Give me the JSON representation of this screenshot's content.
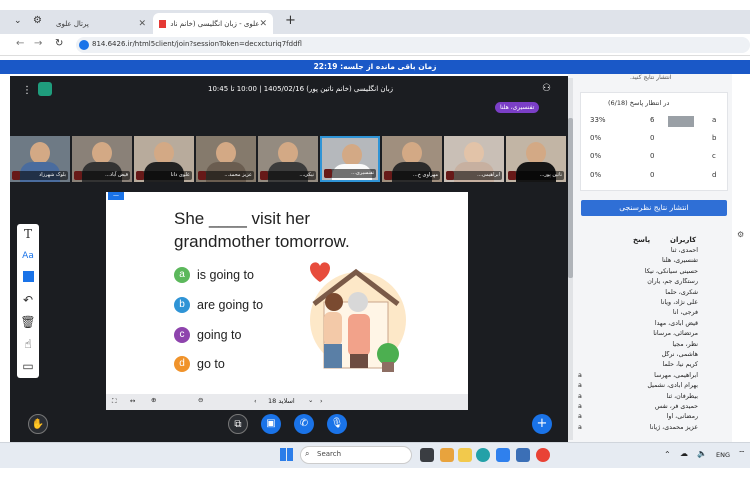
{
  "browser": {
    "tab1_title": "پرتال علوی",
    "tab2_title": "علوی - زبان انگلیسی (خانم ناد",
    "url": "814.6426.ir/html5client/join?sessionToken=decxcturiq7fddfl"
  },
  "meeting": {
    "timer": "زمان باقی مانده از جلسه: 22:19",
    "header_title": "زبان انگلیسی (خانم ناتین پور) 1405/02/16 | 10:00 تا 10:45",
    "presenter": "تفنسیری، هلنا"
  },
  "videos": [
    {
      "name": "بلوک شهرزاد"
    },
    {
      "name": "قیض آباد..."
    },
    {
      "name": "علوی دانا"
    },
    {
      "name": "عزیز محمد..."
    },
    {
      "name": "نیکی..."
    },
    {
      "name": "تفنسیری..."
    },
    {
      "name": "مهراوی خ..."
    },
    {
      "name": "ابراهیمی..."
    },
    {
      "name": "ناتین پور..."
    }
  ],
  "slide": {
    "sentence_line1": "She ____ visit her",
    "sentence_line2": "grandmother tomorrow.",
    "options": [
      {
        "letter": "a",
        "text": "is going to",
        "color": "#5cb85c"
      },
      {
        "letter": "b",
        "text": "are going to",
        "color": "#2f94d6"
      },
      {
        "letter": "c",
        "text": "going to",
        "color": "#8e44ad"
      },
      {
        "letter": "d",
        "text": "go to",
        "color": "#f0932b"
      }
    ],
    "slide_label": "اسلاید 18"
  },
  "poll": {
    "truncated_top": "انتشار نتایج کنید.",
    "waiting": "در انتظار پاسخ (6/18)",
    "rows": [
      {
        "label": "a",
        "count": "6",
        "percent": "33%",
        "fill": 0.33
      },
      {
        "label": "b",
        "count": "0",
        "percent": "0%",
        "fill": 0
      },
      {
        "label": "c",
        "count": "0",
        "percent": "0%",
        "fill": 0
      },
      {
        "label": "d",
        "count": "0",
        "percent": "0%",
        "fill": 0
      }
    ],
    "publish_button": "انتشار نتایج نظرسنجی",
    "col_users": "کاربران",
    "col_answer": "پاسخ",
    "users": [
      {
        "name": "احمدی، ثنا",
        "answer": ""
      },
      {
        "name": "تفنسیری، هلنا",
        "answer": ""
      },
      {
        "name": "حسینی سیانکی، نیکا",
        "answer": ""
      },
      {
        "name": "رستگاری جم، یاران",
        "answer": ""
      },
      {
        "name": "شکری، حلما",
        "answer": ""
      },
      {
        "name": "علی نژاد، ویانا",
        "answer": ""
      },
      {
        "name": "فرجی، آنا",
        "answer": ""
      },
      {
        "name": "قیض آبادی، مهدا",
        "answer": ""
      },
      {
        "name": "مرتضائی، مرسانا",
        "answer": ""
      },
      {
        "name": "نظر، مجیا",
        "answer": ""
      },
      {
        "name": "هاشمی، نرگل",
        "answer": ""
      },
      {
        "name": "کریم نیا، حلما",
        "answer": ""
      },
      {
        "name": "ابراهیمی، مهرسا",
        "answer": "a"
      },
      {
        "name": "بهرام آبادی، نشمیل",
        "answer": "a"
      },
      {
        "name": "بیطرفان، ثنا",
        "answer": "a"
      },
      {
        "name": "حمیدی فر، نفس",
        "answer": "a"
      },
      {
        "name": "رمضانی، آوا",
        "answer": "a"
      },
      {
        "name": "عزیز محمدی، ژیانا",
        "answer": "a"
      }
    ]
  },
  "taskbar": {
    "search_placeholder": "Search",
    "lang": "ENG"
  }
}
